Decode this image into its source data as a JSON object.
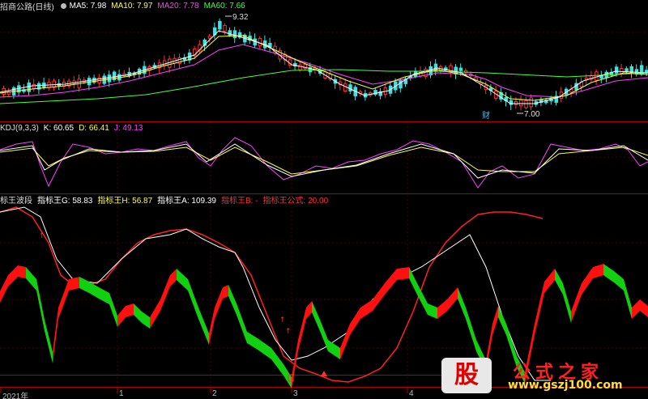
{
  "main_panel": {
    "stock_name": "招商公路",
    "period": "(日线)",
    "ma": [
      {
        "label": "MA5: 7.98",
        "color": "#ffffff"
      },
      {
        "label": "MA10: 7.97",
        "color": "#ffff40"
      },
      {
        "label": "MA20: 7.78",
        "color": "#ff40ff"
      },
      {
        "label": "MA60: 7.66",
        "color": "#40ff40"
      }
    ],
    "high_mark": "9.32",
    "low_mark": "7.00",
    "event_mark": "财"
  },
  "kdj_panel": {
    "name": "KDJ(9,3,3)",
    "k": "K: 60.65",
    "d": "D: 66.41",
    "j": "J: 49.13",
    "colors": {
      "k": "#ffffff",
      "d": "#ffff40",
      "j": "#ff40ff"
    }
  },
  "wave_panel": {
    "name": "标王波段",
    "g": "指标王G: 58.83",
    "h": "指标王H: 56.87",
    "a": "指标王A: 109.39",
    "b": "指标王B: -",
    "formula": "指标王公式: 20.00",
    "colors": {
      "g": "#ffffff",
      "h": "#ffff40",
      "a": "#ffffff",
      "b": "#ff3030",
      "formula": "#ff3030"
    }
  },
  "time_axis": [
    "2021年",
    "1",
    "2",
    "3",
    "4"
  ],
  "watermark": {
    "logo_text": "股",
    "title": "公式之家",
    "url": "www.gszj100.com"
  }
}
